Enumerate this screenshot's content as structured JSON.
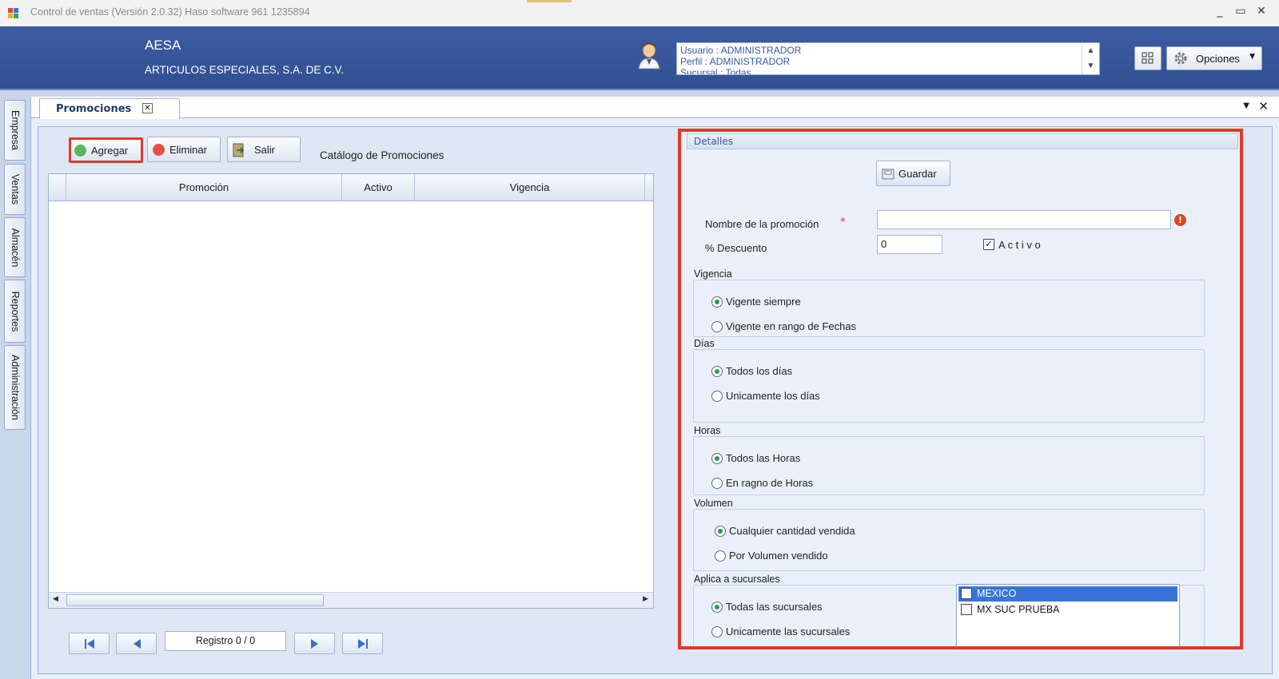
{
  "window": {
    "title": "Control de ventas  (Versión 2.0.32)  Haso software  961 1235894",
    "minimize": "_",
    "restore": "▭",
    "close": "✕"
  },
  "header": {
    "company_name": "AESA",
    "company_full": "ARTICULOS ESPECIALES, S.A. DE C.V.",
    "user_lines": [
      "Usuario : ADMINISTRADOR",
      "Perfil : ADMINISTRADOR",
      "Sucursal : Todas"
    ],
    "options_label": "Opciones"
  },
  "sidebar": {
    "tabs": [
      "Empresa",
      "Ventas",
      "Almacén",
      "Reportes",
      "Administración"
    ]
  },
  "document": {
    "tab_label": "Promociones",
    "tab_close": "✕"
  },
  "toolbar": {
    "add_label": "Agregar",
    "delete_label": "Eliminar",
    "exit_label": "Salir",
    "catalog_title": "Catálogo de Promociones"
  },
  "grid": {
    "columns": [
      "Promoción",
      "Activo",
      "Vigencia"
    ]
  },
  "navigator": {
    "record_text": "Registro 0 / 0"
  },
  "details": {
    "header": "Detalles",
    "save_label": "Guardar",
    "name_label": "Nombre de la promoción",
    "required_mark": "*",
    "name_value": "",
    "discount_label": "% Descuento",
    "discount_value": "0",
    "active_label": "A c t i v o",
    "active_checked": true,
    "groups": {
      "vigencia": {
        "title": "Vigencia",
        "options": [
          "Vigente siempre",
          "Vigente en rango de Fechas"
        ]
      },
      "dias": {
        "title": "Días",
        "options": [
          "Todos los días",
          "Unicamente los días"
        ]
      },
      "horas": {
        "title": "Horas",
        "options": [
          "Todos las Horas",
          "En ragno de Horas"
        ]
      },
      "volumen": {
        "title": "Volumen",
        "options": [
          "Cualquier cantidad vendida",
          "Por Volumen vendido"
        ]
      },
      "sucursales": {
        "title": "Aplica a sucursales",
        "options": [
          "Todas las sucursales",
          "Unicamente las sucursales"
        ]
      }
    },
    "branch_list": [
      "MEXICO",
      "MX SUC PRUEBA"
    ]
  },
  "colors": {
    "header_blue": "#3d5ca2",
    "highlight_red": "#e0392a",
    "selected_blue": "#3975d6",
    "radio_green": "#2c9a46"
  }
}
